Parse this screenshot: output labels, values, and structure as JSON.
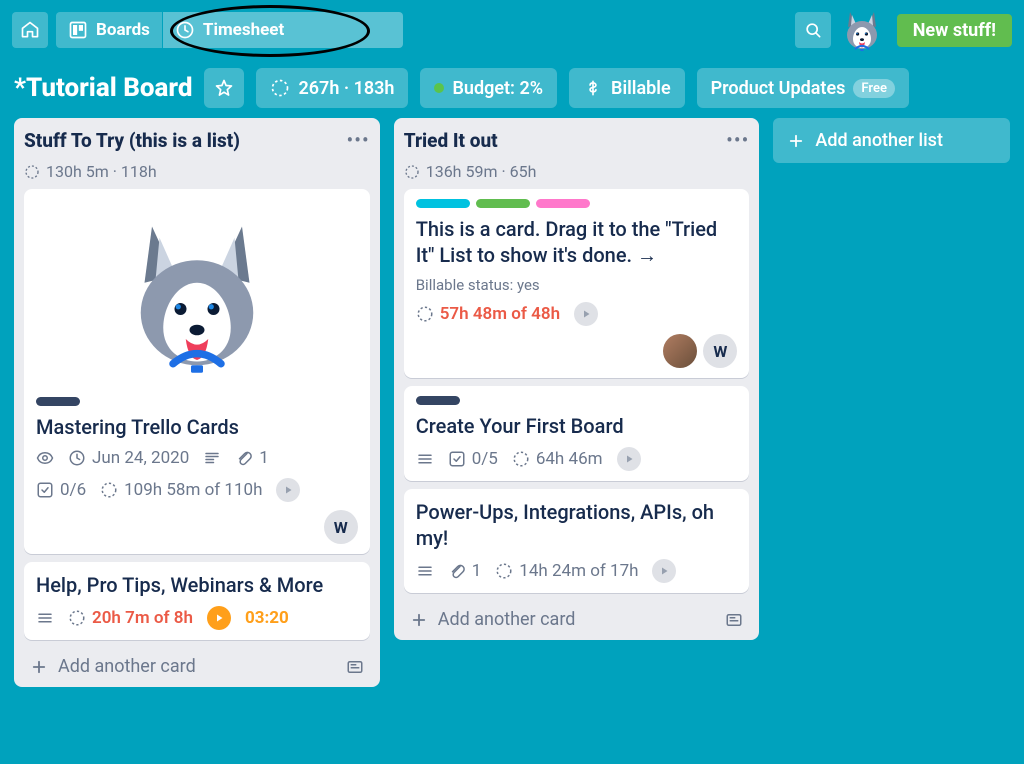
{
  "topnav": {
    "boards_label": "Boards",
    "timesheet_label": "Timesheet",
    "new_stuff_label": "New stuff!"
  },
  "boardbar": {
    "title": "*Tutorial Board",
    "hours_summary": "267h · 183h",
    "budget_label": "Budget: 2%",
    "billable_label": "Billable",
    "product_updates_label": "Product Updates",
    "free_badge": "Free"
  },
  "lists": [
    {
      "title": "Stuff To Try (this is a list)",
      "subtitle": "130h 5m · 118h",
      "cards": [
        {
          "title": "Mastering Trello Cards",
          "date": "Jun 24, 2020",
          "attach_count": "1",
          "checklist": "0/6",
          "time": "109h 58m of 110h",
          "member_initial": "W"
        },
        {
          "title": "Help, Pro Tips, Webinars & More",
          "time": "20h 7m of 8h",
          "timer": "03:20"
        }
      ],
      "add_card_label": "Add another card"
    },
    {
      "title": "Tried It out",
      "subtitle": "136h 59m · 65h",
      "cards": [
        {
          "title": "This is a card. Drag it to the \"Tried It\" List to show it's done. →",
          "billable_status": "Billable status: yes",
          "time": "57h 48m of 48h",
          "member_initial": "W"
        },
        {
          "title": "Create Your First Board",
          "checklist": "0/5",
          "time": "64h 46m"
        },
        {
          "title": "Power-Ups, Integrations, APIs, oh my!",
          "attach_count": "1",
          "time": "14h 24m of 17h"
        }
      ],
      "add_card_label": "Add another card"
    }
  ],
  "add_list_label": "Add another list"
}
